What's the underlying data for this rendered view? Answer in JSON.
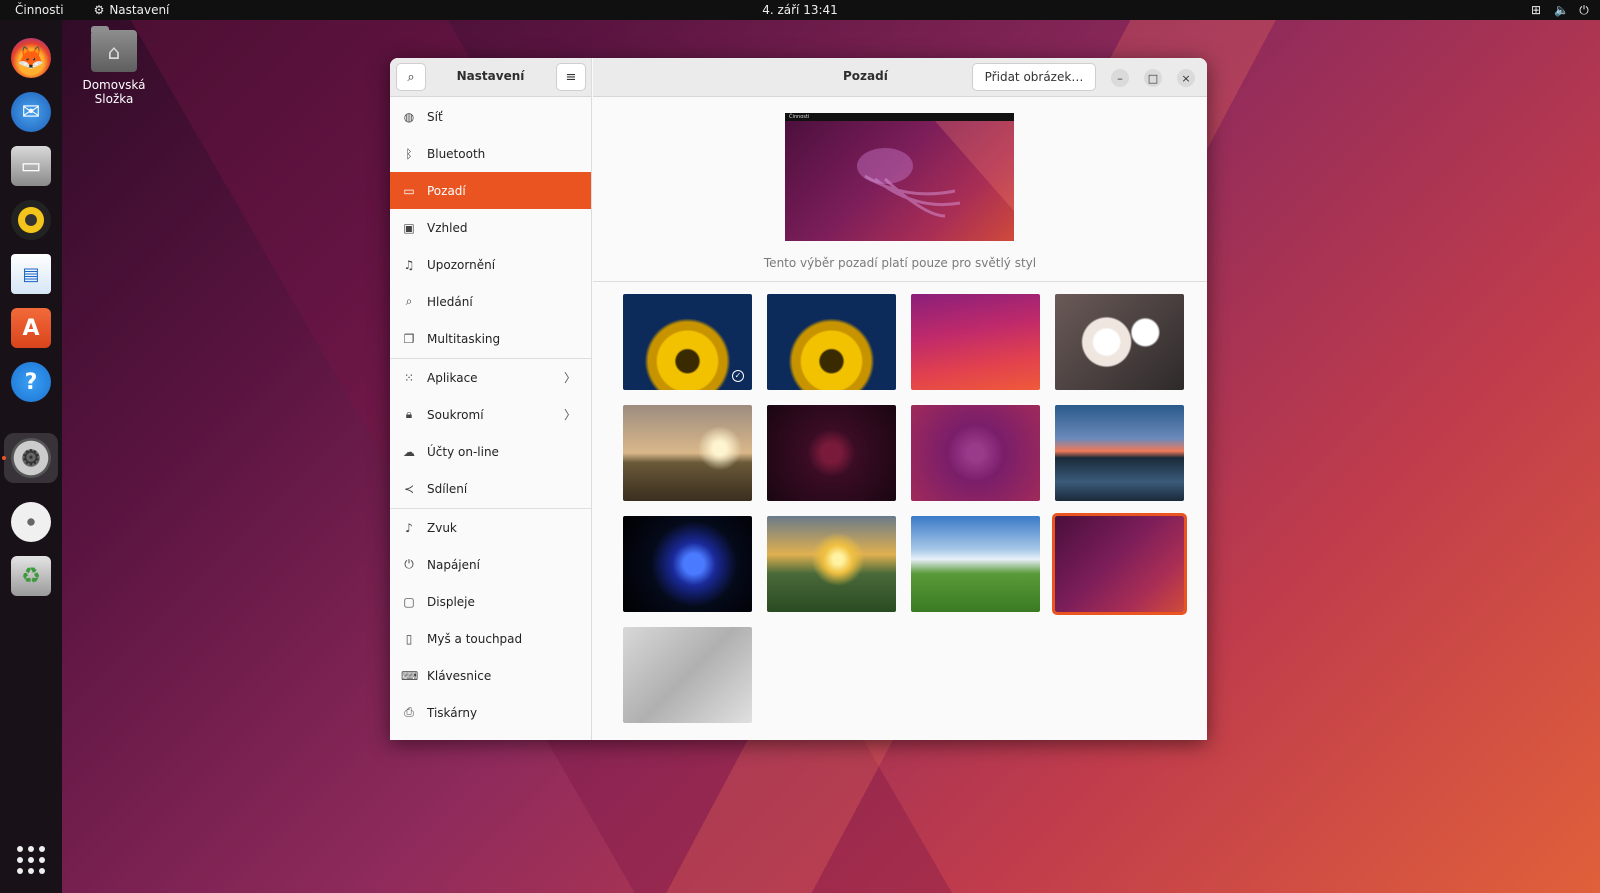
{
  "topbar": {
    "activities": "Činnosti",
    "app_name": "Nastavení",
    "clock": "4. září  13:41",
    "tray_icons": [
      "network-icon",
      "volume-icon",
      "power-icon"
    ]
  },
  "dock": {
    "items": [
      "firefox-icon",
      "thunderbird-icon",
      "files-icon",
      "rhythmbox-icon",
      "writer-icon",
      "software-icon",
      "help-icon",
      "settings-icon",
      "disc-icon",
      "trash-icon"
    ],
    "active_item": "settings-icon"
  },
  "desktop": {
    "home_label": "Domovská Složka"
  },
  "sidebar": {
    "title": "Nastavení",
    "items": [
      {
        "label": "Síť",
        "icon": "globe-icon"
      },
      {
        "label": "Bluetooth",
        "icon": "bluetooth-icon"
      },
      {
        "label": "Pozadí",
        "icon": "monitor-icon",
        "active": true
      },
      {
        "label": "Vzhled",
        "icon": "appearance-icon"
      },
      {
        "label": "Upozornění",
        "icon": "bell-icon"
      },
      {
        "label": "Hledání",
        "icon": "search-icon"
      },
      {
        "label": "Multitasking",
        "icon": "windows-icon"
      },
      {
        "label": "Aplikace",
        "icon": "grid-icon",
        "has_submenu": true
      },
      {
        "label": "Soukromí",
        "icon": "lock-icon",
        "has_submenu": true
      },
      {
        "label": "Účty on-line",
        "icon": "cloud-icon"
      },
      {
        "label": "Sdílení",
        "icon": "share-icon"
      },
      {
        "label": "Zvuk",
        "icon": "music-note-icon"
      },
      {
        "label": "Napájení",
        "icon": "power-icon"
      },
      {
        "label": "Displeje",
        "icon": "display-icon"
      },
      {
        "label": "Myš a touchpad",
        "icon": "mouse-icon"
      },
      {
        "label": "Klávesnice",
        "icon": "keyboard-icon"
      },
      {
        "label": "Tiskárny",
        "icon": "printer-icon"
      }
    ]
  },
  "main": {
    "title": "Pozadí",
    "add_button": "Přidat obrázek…",
    "preview_topbar": "Činnosti",
    "note": "Tento výběr pozadí platí pouze pro světlý styl",
    "selected_wallpaper": "jellyfish-gradient",
    "wallpapers": [
      "sunflower-dark",
      "sunflower",
      "purple-waves",
      "white-blossoms",
      "sunset-boardwalk",
      "dark-jellyfish-logo",
      "purple-jellyfish-logo",
      "lake-sunset",
      "blue-jellyfish",
      "valley-sunset",
      "green-hills",
      "jellyfish-gradient",
      "grey-jellyfish"
    ]
  },
  "colors": {
    "accent": "#e95420"
  }
}
